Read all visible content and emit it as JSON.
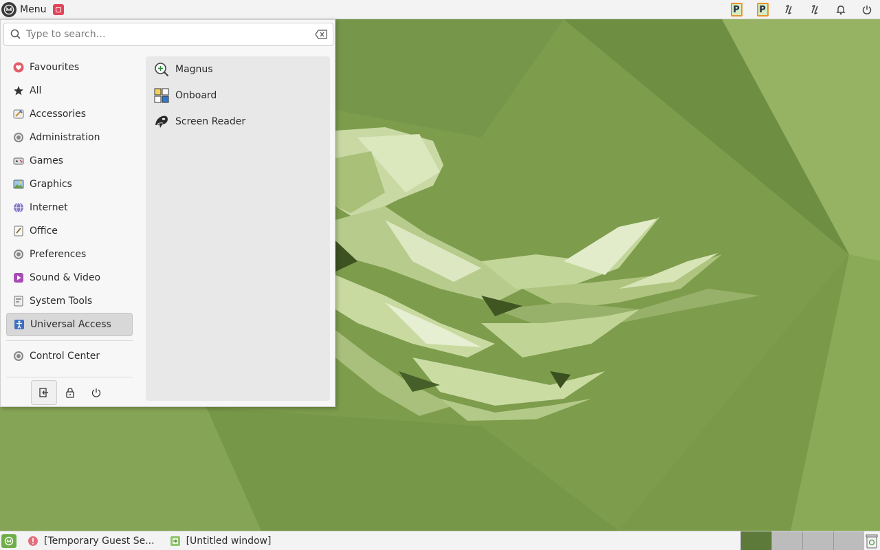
{
  "top_panel": {
    "menu_label": "Menu",
    "tray_icons": [
      "pager-p-icon",
      "pager-p-icon",
      "network-icon",
      "network-icon",
      "bell-icon",
      "power-icon"
    ]
  },
  "menu": {
    "search_placeholder": "Type to search…",
    "categories": [
      {
        "label": "Favourites",
        "icon": "heart-icon"
      },
      {
        "label": "All",
        "icon": "star-icon"
      },
      {
        "label": "Accessories",
        "icon": "accessories-icon"
      },
      {
        "label": "Administration",
        "icon": "gear-icon"
      },
      {
        "label": "Games",
        "icon": "gamepad-icon"
      },
      {
        "label": "Graphics",
        "icon": "image-icon"
      },
      {
        "label": "Internet",
        "icon": "globe-icon"
      },
      {
        "label": "Office",
        "icon": "document-icon"
      },
      {
        "label": "Preferences",
        "icon": "gear-icon"
      },
      {
        "label": "Sound & Video",
        "icon": "media-icon"
      },
      {
        "label": "System Tools",
        "icon": "tools-icon"
      },
      {
        "label": "Universal Access",
        "icon": "accessibility-icon"
      }
    ],
    "selected_category": "Universal Access",
    "control_center": "Control Center",
    "apps": [
      {
        "label": "Magnus",
        "icon": "magnifier-icon"
      },
      {
        "label": "Onboard",
        "icon": "keyboard-icon"
      },
      {
        "label": "Screen Reader",
        "icon": "orca-icon"
      }
    ]
  },
  "taskbar": {
    "tasks": [
      {
        "label": "[Temporary Guest Se...",
        "icon": "alert-icon"
      },
      {
        "label": "[Untitled window]",
        "icon": "window-icon"
      }
    ]
  },
  "colors": {
    "wallpaper": "#7b9a4b",
    "menu_bg": "#f7f7f7",
    "selected_bg": "#d8d8d8",
    "accent_green": "#6fae48"
  }
}
